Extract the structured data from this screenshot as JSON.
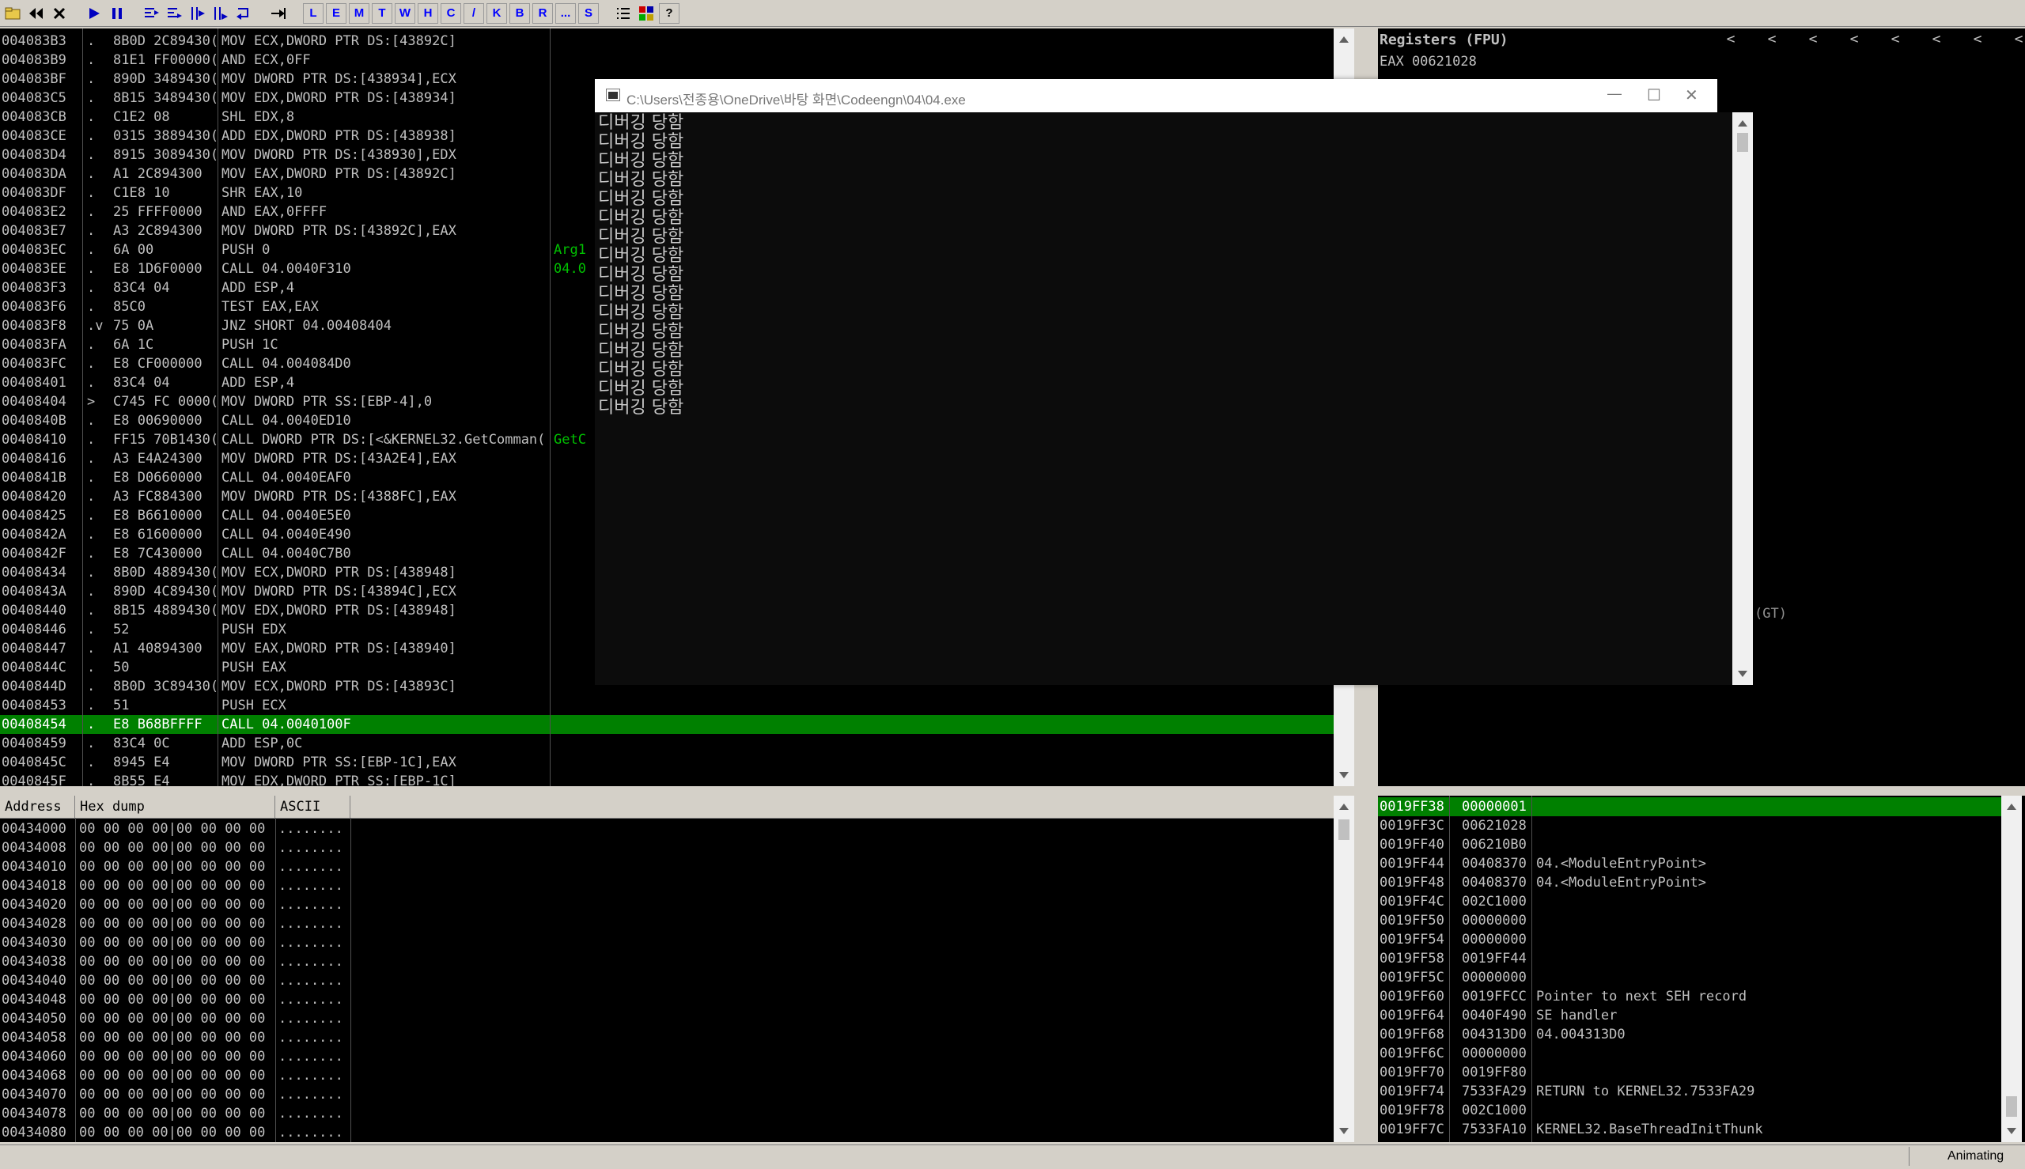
{
  "toolbar": {
    "icons": [
      "open-icon",
      "rewind-icon",
      "close-icon",
      "run-icon",
      "pause-icon",
      "step-into-icon",
      "step-over-icon",
      "trace-into-icon",
      "trace-over-icon",
      "execute-till-return-icon",
      "goto-icon"
    ],
    "letters": [
      "L",
      "E",
      "M",
      "T",
      "W",
      "H",
      "C",
      "/",
      "K",
      "B",
      "R",
      "...",
      "S"
    ],
    "right_icons": [
      "list-icon",
      "grid-icon"
    ],
    "help": "?"
  },
  "disasm": {
    "rows": [
      {
        "addr": "004083B3",
        "m": ".",
        "hex": "8B0D 2C89430(",
        "ins": "MOV ECX,DWORD PTR DS:[43892C]"
      },
      {
        "addr": "004083B9",
        "m": ".",
        "hex": "81E1 FF00000(",
        "ins": "AND ECX,0FF"
      },
      {
        "addr": "004083BF",
        "m": ".",
        "hex": "890D 3489430(",
        "ins": "MOV DWORD PTR DS:[438934],ECX"
      },
      {
        "addr": "004083C5",
        "m": ".",
        "hex": "8B15 3489430(",
        "ins": "MOV EDX,DWORD PTR DS:[438934]"
      },
      {
        "addr": "004083CB",
        "m": ".",
        "hex": "C1E2 08",
        "ins": "SHL EDX,8"
      },
      {
        "addr": "004083CE",
        "m": ".",
        "hex": "0315 3889430(",
        "ins": "ADD EDX,DWORD PTR DS:[438938]"
      },
      {
        "addr": "004083D4",
        "m": ".",
        "hex": "8915 3089430(",
        "ins": "MOV DWORD PTR DS:[438930],EDX"
      },
      {
        "addr": "004083DA",
        "m": ".",
        "hex": "A1 2C894300",
        "ins": "MOV EAX,DWORD PTR DS:[43892C]"
      },
      {
        "addr": "004083DF",
        "m": ".",
        "hex": "C1E8 10",
        "ins": "SHR EAX,10"
      },
      {
        "addr": "004083E2",
        "m": ".",
        "hex": "25 FFFF0000",
        "ins": "AND EAX,0FFFF"
      },
      {
        "addr": "004083E7",
        "m": ".",
        "hex": "A3 2C894300",
        "ins": "MOV DWORD PTR DS:[43892C],EAX"
      },
      {
        "addr": "004083EC",
        "m": ".",
        "hex": "6A 00",
        "ins": "PUSH 0",
        "cmt": "Arg1"
      },
      {
        "addr": "004083EE",
        "m": ".",
        "hex": "E8 1D6F0000",
        "ins": "CALL 04.0040F310",
        "cmt": "04.0"
      },
      {
        "addr": "004083F3",
        "m": ".",
        "hex": "83C4 04",
        "ins": "ADD ESP,4"
      },
      {
        "addr": "004083F6",
        "m": ".",
        "hex": "85C0",
        "ins": "TEST EAX,EAX"
      },
      {
        "addr": "004083F8",
        "m": ".v",
        "hex": "75 0A",
        "ins": "JNZ SHORT 04.00408404"
      },
      {
        "addr": "004083FA",
        "m": ".",
        "hex": "6A 1C",
        "ins": "PUSH 1C"
      },
      {
        "addr": "004083FC",
        "m": ".",
        "hex": "E8 CF000000",
        "ins": "CALL 04.004084D0"
      },
      {
        "addr": "00408401",
        "m": ".",
        "hex": "83C4 04",
        "ins": "ADD ESP,4"
      },
      {
        "addr": "00408404",
        "m": ">",
        "hex": "C745 FC 0000(",
        "ins": "MOV DWORD PTR SS:[EBP-4],0"
      },
      {
        "addr": "0040840B",
        "m": ".",
        "hex": "E8 00690000",
        "ins": "CALL 04.0040ED10"
      },
      {
        "addr": "00408410",
        "m": ".",
        "hex": "FF15 70B1430(",
        "ins": "CALL DWORD PTR DS:[<&KERNEL32.GetComman(",
        "cmt": "GetC"
      },
      {
        "addr": "00408416",
        "m": ".",
        "hex": "A3 E4A24300",
        "ins": "MOV DWORD PTR DS:[43A2E4],EAX"
      },
      {
        "addr": "0040841B",
        "m": ".",
        "hex": "E8 D0660000",
        "ins": "CALL 04.0040EAF0"
      },
      {
        "addr": "00408420",
        "m": ".",
        "hex": "A3 FC884300",
        "ins": "MOV DWORD PTR DS:[4388FC],EAX"
      },
      {
        "addr": "00408425",
        "m": ".",
        "hex": "E8 B6610000",
        "ins": "CALL 04.0040E5E0"
      },
      {
        "addr": "0040842A",
        "m": ".",
        "hex": "E8 61600000",
        "ins": "CALL 04.0040E490"
      },
      {
        "addr": "0040842F",
        "m": ".",
        "hex": "E8 7C430000",
        "ins": "CALL 04.0040C7B0"
      },
      {
        "addr": "00408434",
        "m": ".",
        "hex": "8B0D 4889430(",
        "ins": "MOV ECX,DWORD PTR DS:[438948]"
      },
      {
        "addr": "0040843A",
        "m": ".",
        "hex": "890D 4C89430(",
        "ins": "MOV DWORD PTR DS:[43894C],ECX"
      },
      {
        "addr": "00408440",
        "m": ".",
        "hex": "8B15 4889430(",
        "ins": "MOV EDX,DWORD PTR DS:[438948]"
      },
      {
        "addr": "00408446",
        "m": ".",
        "hex": "52",
        "ins": "PUSH EDX"
      },
      {
        "addr": "00408447",
        "m": ".",
        "hex": "A1 40894300",
        "ins": "MOV EAX,DWORD PTR DS:[438940]"
      },
      {
        "addr": "0040844C",
        "m": ".",
        "hex": "50",
        "ins": "PUSH EAX"
      },
      {
        "addr": "0040844D",
        "m": ".",
        "hex": "8B0D 3C89430(",
        "ins": "MOV ECX,DWORD PTR DS:[43893C]"
      },
      {
        "addr": "00408453",
        "m": ".",
        "hex": "51",
        "ins": "PUSH ECX"
      },
      {
        "addr": "00408454",
        "m": ".",
        "hex": "E8 B68BFFFF",
        "ins": "CALL 04.0040100F",
        "hl": true
      },
      {
        "addr": "00408459",
        "m": ".",
        "hex": "83C4 0C",
        "ins": "ADD ESP,0C"
      },
      {
        "addr": "0040845C",
        "m": ".",
        "hex": "8945 E4",
        "ins": "MOV DWORD PTR SS:[EBP-1C],EAX"
      },
      {
        "addr": "0040845F",
        "m": ".",
        "hex": "8B55 E4",
        "ins": "MOV EDX,DWORD PTR SS:[EBP-1C]"
      }
    ]
  },
  "registers": {
    "title": "Registers (FPU)",
    "arrows": [
      "<",
      "<",
      "<",
      "<",
      "<",
      "<",
      "<",
      "<"
    ],
    "eax": "EAX 00621028",
    "gt": "(GT)"
  },
  "console": {
    "title": "C:\\Users\\전종용\\OneDrive\\바탕 화면\\Codeengn\\04\\04.exe",
    "min": "—",
    "max": "☐",
    "close": "✕",
    "lines": [
      "디버깅 당함",
      "디버깅 당함",
      "디버깅 당함",
      "디버깅 당함",
      "디버깅 당함",
      "디버깅 당함",
      "디버깅 당함",
      "디버깅 당함",
      "디버깅 당함",
      "디버깅 당함",
      "디버깅 당함",
      "디버깅 당함",
      "디버깅 당함",
      "디버깅 당함",
      "디버깅 당함",
      "디버깅 당함"
    ]
  },
  "dump": {
    "headers": [
      "Address",
      "Hex dump",
      "ASCII"
    ],
    "rows": [
      {
        "addr": "00434000",
        "hex": "00 00 00 00|00 00 00 00",
        "ascii": "........"
      },
      {
        "addr": "00434008",
        "hex": "00 00 00 00|00 00 00 00",
        "ascii": "........"
      },
      {
        "addr": "00434010",
        "hex": "00 00 00 00|00 00 00 00",
        "ascii": "........"
      },
      {
        "addr": "00434018",
        "hex": "00 00 00 00|00 00 00 00",
        "ascii": "........"
      },
      {
        "addr": "00434020",
        "hex": "00 00 00 00|00 00 00 00",
        "ascii": "........"
      },
      {
        "addr": "00434028",
        "hex": "00 00 00 00|00 00 00 00",
        "ascii": "........"
      },
      {
        "addr": "00434030",
        "hex": "00 00 00 00|00 00 00 00",
        "ascii": "........"
      },
      {
        "addr": "00434038",
        "hex": "00 00 00 00|00 00 00 00",
        "ascii": "........"
      },
      {
        "addr": "00434040",
        "hex": "00 00 00 00|00 00 00 00",
        "ascii": "........"
      },
      {
        "addr": "00434048",
        "hex": "00 00 00 00|00 00 00 00",
        "ascii": "........"
      },
      {
        "addr": "00434050",
        "hex": "00 00 00 00|00 00 00 00",
        "ascii": "........"
      },
      {
        "addr": "00434058",
        "hex": "00 00 00 00|00 00 00 00",
        "ascii": "........"
      },
      {
        "addr": "00434060",
        "hex": "00 00 00 00|00 00 00 00",
        "ascii": "........"
      },
      {
        "addr": "00434068",
        "hex": "00 00 00 00|00 00 00 00",
        "ascii": "........"
      },
      {
        "addr": "00434070",
        "hex": "00 00 00 00|00 00 00 00",
        "ascii": "........"
      },
      {
        "addr": "00434078",
        "hex": "00 00 00 00|00 00 00 00",
        "ascii": "........"
      },
      {
        "addr": "00434080",
        "hex": "00 00 00 00|00 00 00 00",
        "ascii": "........"
      }
    ]
  },
  "stack": {
    "rows": [
      {
        "addr": "0019FF38",
        "val": "00000001",
        "cmt": "",
        "hl": true
      },
      {
        "addr": "0019FF3C",
        "val": "00621028",
        "cmt": ""
      },
      {
        "addr": "0019FF40",
        "val": "006210B0",
        "cmt": ""
      },
      {
        "addr": "0019FF44",
        "val": "00408370",
        "cmt": "04.<ModuleEntryPoint>"
      },
      {
        "addr": "0019FF48",
        "val": "00408370",
        "cmt": "04.<ModuleEntryPoint>"
      },
      {
        "addr": "0019FF4C",
        "val": "002C1000",
        "cmt": ""
      },
      {
        "addr": "0019FF50",
        "val": "00000000",
        "cmt": ""
      },
      {
        "addr": "0019FF54",
        "val": "00000000",
        "cmt": ""
      },
      {
        "addr": "0019FF58",
        "val": "0019FF44",
        "cmt": ""
      },
      {
        "addr": "0019FF5C",
        "val": "00000000",
        "cmt": ""
      },
      {
        "addr": "0019FF60",
        "val": "0019FFCC",
        "cmt": "Pointer to next SEH record"
      },
      {
        "addr": "0019FF64",
        "val": "0040F490",
        "cmt": "SE handler"
      },
      {
        "addr": "0019FF68",
        "val": "004313D0",
        "cmt": "04.004313D0"
      },
      {
        "addr": "0019FF6C",
        "val": "00000000",
        "cmt": ""
      },
      {
        "addr": "0019FF70",
        "val": "0019FF80",
        "cmt": ""
      },
      {
        "addr": "0019FF74",
        "val": "7533FA29",
        "cmt": "RETURN to KERNEL32.7533FA29"
      },
      {
        "addr": "0019FF78",
        "val": "002C1000",
        "cmt": ""
      },
      {
        "addr": "0019FF7C",
        "val": "7533FA10",
        "cmt": "KERNEL32.BaseThreadInitThunk"
      }
    ]
  },
  "status": {
    "text": "Animating"
  }
}
